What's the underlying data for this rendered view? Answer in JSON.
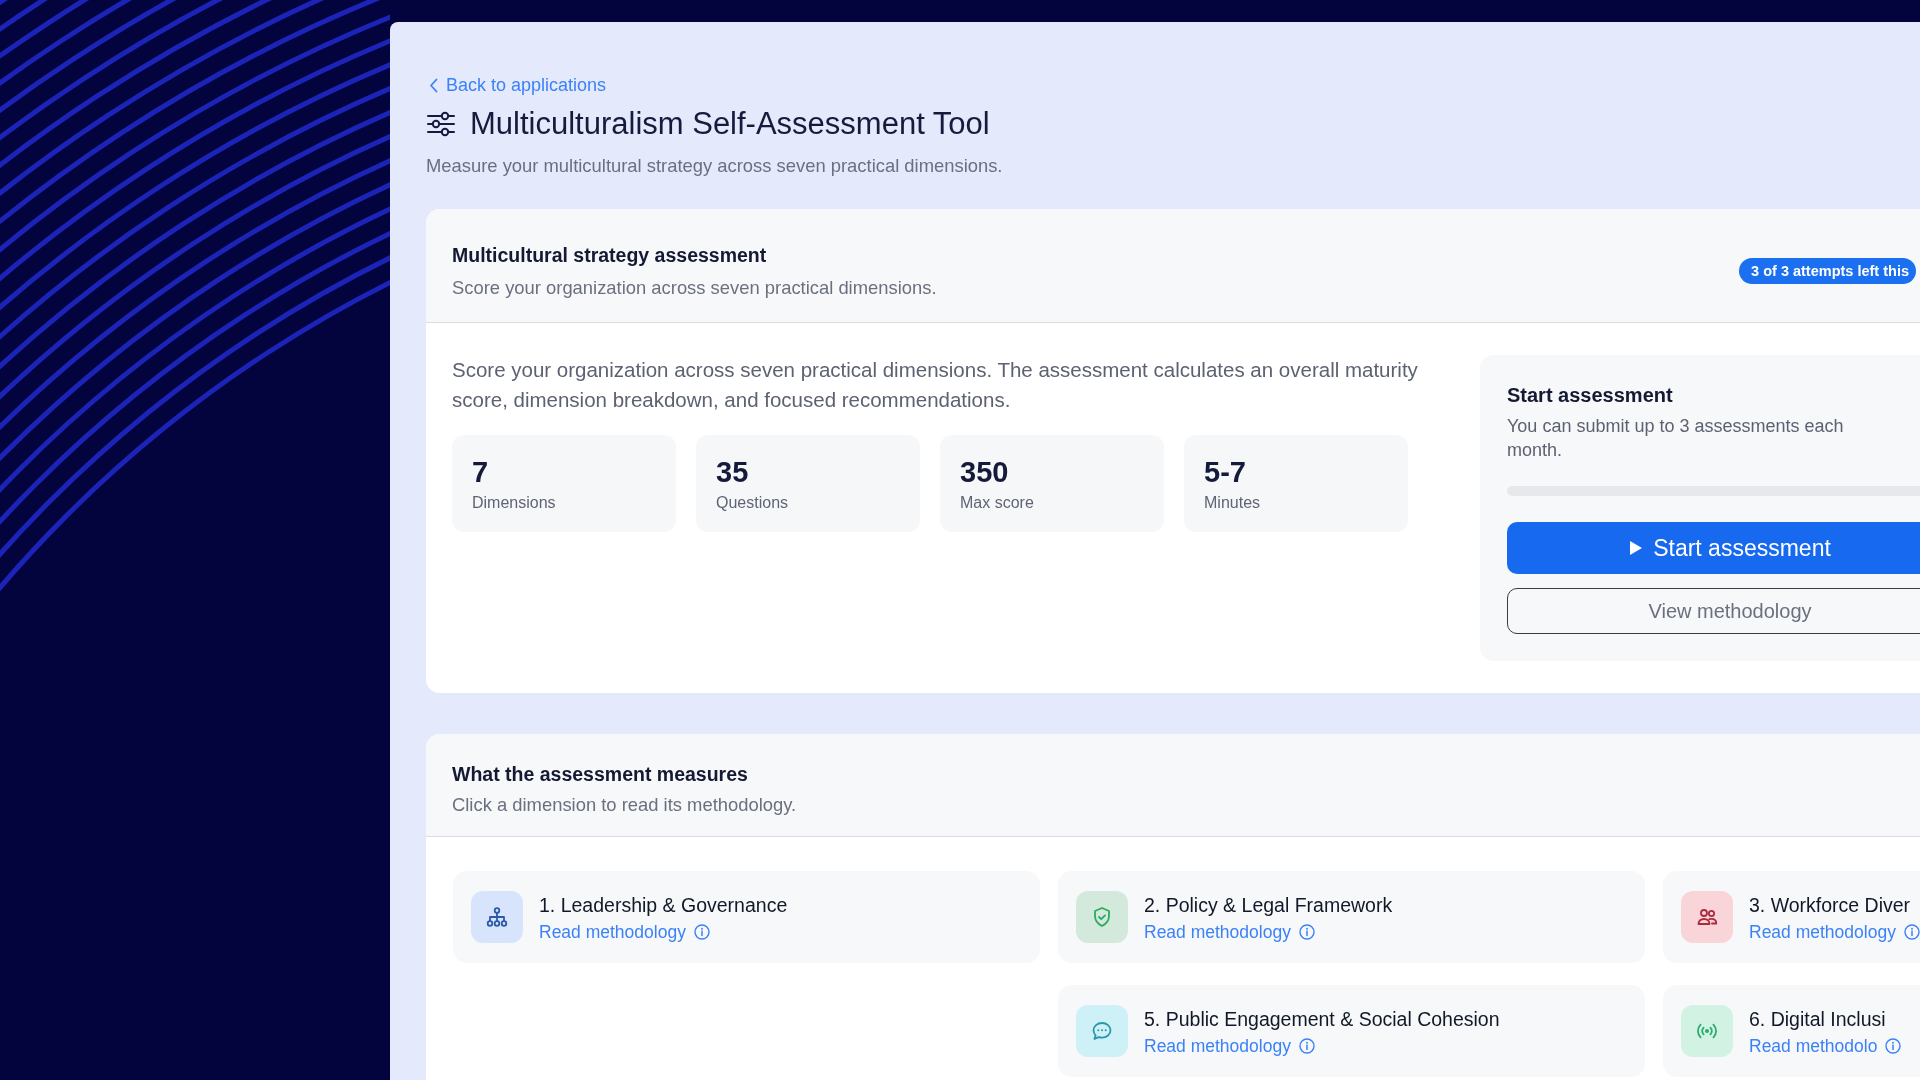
{
  "back_link": {
    "label": "Back to applications"
  },
  "header": {
    "title": "Multiculturalism Self-Assessment Tool",
    "subtitle": "Measure your multicultural strategy across seven practical dimensions."
  },
  "overview_card": {
    "title": "Multicultural strategy assessment",
    "subtitle": "Score your organization across seven practical dimensions.",
    "badge": "3 of 3 attempts left this",
    "description": "Score your organization across seven practical dimensions. The assessment calculates an overall maturity score, dimension breakdown, and focused recommendations.",
    "stats": [
      {
        "value": "7",
        "label": "Dimensions"
      },
      {
        "value": "35",
        "label": "Questions"
      },
      {
        "value": "350",
        "label": "Max score"
      },
      {
        "value": "5-7",
        "label": "Minutes"
      }
    ]
  },
  "start_panel": {
    "title": "Start assessment",
    "text": "You can submit up to 3 assessments each month.",
    "usage": {
      "level": 0
    },
    "buttons": [
      {
        "kind": "primary",
        "label": "Start assessment"
      },
      {
        "kind": "secondary",
        "label": "View methodology"
      }
    ]
  },
  "measures_card": {
    "title": "What the assessment measures",
    "subtitle": "Click a dimension to read its methodology.",
    "columns": [
      {
        "cards": [
          {
            "title": "1. Leadership & Governance",
            "link": "Read methodology",
            "color": "#d7e4fb"
          }
        ]
      },
      {
        "cards": [
          {
            "title": "2. Policy & Legal Framework",
            "link": "Read methodology",
            "color": "#d3e9dc"
          },
          {
            "title": "5. Public Engagement & Social Cohesion",
            "link": "Read methodology",
            "color": "#cef0f7"
          }
        ]
      },
      {
        "cards": [
          {
            "title": "3. Workforce Diver",
            "link": "Read methodology",
            "color": "#f9d4d9"
          },
          {
            "title": "6. Digital Inclusi",
            "link": "Read methodolo",
            "color": "#d2f2e3"
          }
        ]
      }
    ]
  }
}
